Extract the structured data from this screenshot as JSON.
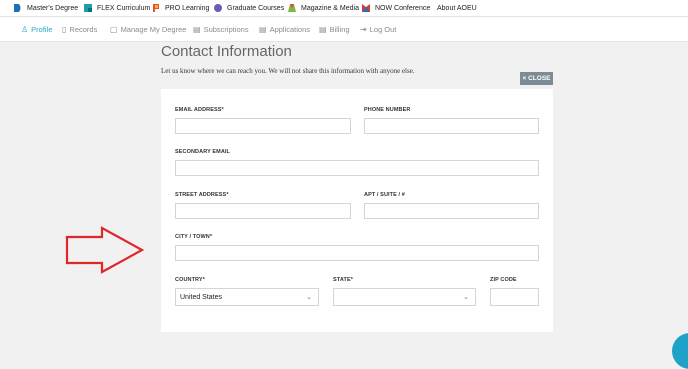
{
  "topbar": {
    "items": [
      {
        "label": "Master's Degree",
        "icon": "masters-degree-icon",
        "color": "#1d6fb8"
      },
      {
        "label": "FLEX Curriculum",
        "icon": "flex-curriculum-icon",
        "color": "#1aa0a8"
      },
      {
        "label": "PRO Learning",
        "icon": "pro-learning-icon",
        "color": "#e5502d"
      },
      {
        "label": "Graduate Courses",
        "icon": "graduate-courses-icon",
        "color": "#6a5bb5"
      },
      {
        "label": "Magazine & Media",
        "icon": "magazine-media-icon",
        "color": "#79b93b"
      },
      {
        "label": "NOW Conference",
        "icon": "now-conference-icon",
        "color": "#d63b3b"
      },
      {
        "label": "About AOEU"
      }
    ]
  },
  "nav": {
    "items": [
      {
        "label": "Profile",
        "icon": "profile-icon",
        "active": true
      },
      {
        "label": "Records",
        "icon": "records-icon"
      },
      {
        "label": "Manage My Degree",
        "icon": "manage-degree-icon"
      },
      {
        "label": "Subscriptions",
        "icon": "subscriptions-icon"
      },
      {
        "label": "Applications",
        "icon": "applications-icon"
      },
      {
        "label": "Billing",
        "icon": "billing-icon"
      },
      {
        "label": "Log Out",
        "icon": "log-out-icon"
      }
    ],
    "active_color": "#2aa5c9"
  },
  "page": {
    "title": "Contact Information",
    "subtitle": "Let us know where we can reach you. We will not share this information with anyone else.",
    "close_label": "× CLOSE"
  },
  "form": {
    "email_label": "EMAIL ADDRESS*",
    "email_value": "",
    "phone_label": "PHONE NUMBER",
    "phone_value": "",
    "secondary_email_label": "SECONDARY EMAIL",
    "secondary_email_value": "",
    "street_label": "STREET ADDRESS*",
    "street_value": "",
    "apt_label": "APT / SUITE / #",
    "apt_value": "",
    "city_label": "CITY / TOWN*",
    "city_value": "",
    "country_label": "COUNTRY*",
    "country_value": "United States",
    "state_label": "STATE*",
    "state_value": "",
    "zip_label": "ZIP CODE",
    "zip_value": ""
  },
  "annotation": {
    "icon": "red-arrow-icon",
    "color": "#e0262a"
  }
}
